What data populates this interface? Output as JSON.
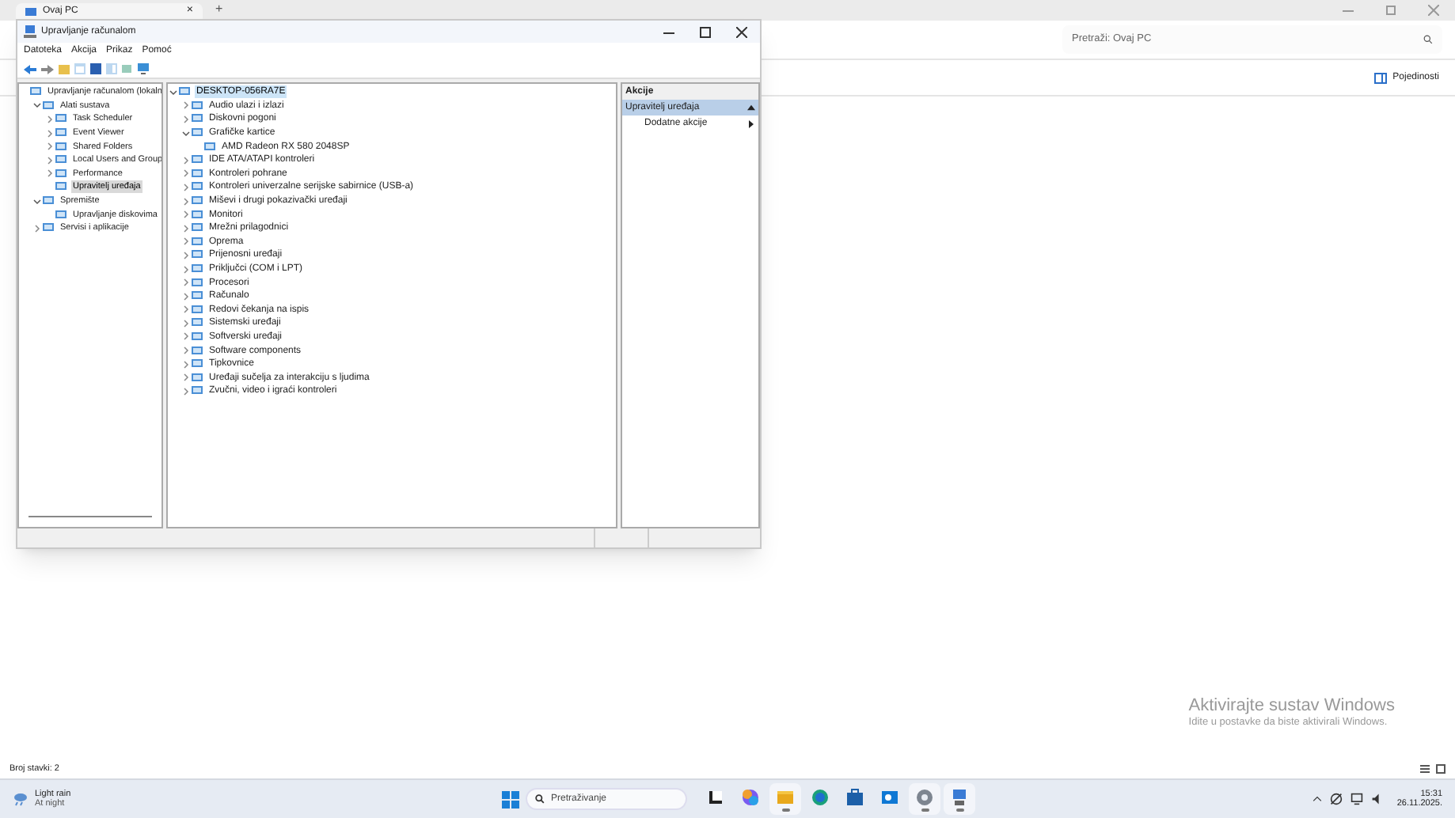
{
  "explorer": {
    "tab_title": "Ovaj PC",
    "tab_close": "×",
    "new_tab": "+",
    "search": {
      "placeholder": "Pretraži: Ovaj PC"
    },
    "details_button": "Pojedinosti",
    "status": "Broj stavki: 2"
  },
  "window": {
    "title": "Upravljanje računalom",
    "menu": [
      "Datoteka",
      "Akcija",
      "Prikaz",
      "Pomoć"
    ],
    "console_tree": [
      {
        "label": "Upravljanje računalom (lokaln",
        "selected": false,
        "children": [
          {
            "label": "Alati sustava",
            "expanded": true,
            "selected": false,
            "children": [
              {
                "label": "Task Scheduler",
                "expanded": false,
                "selected": false
              },
              {
                "label": "Event Viewer",
                "expanded": false,
                "selected": false
              },
              {
                "label": "Shared Folders",
                "expanded": false,
                "selected": false
              },
              {
                "label": "Local Users and Group",
                "expanded": false,
                "selected": false
              },
              {
                "label": "Performance",
                "expanded": false,
                "selected": false
              },
              {
                "label": "Upravitelj uređaja",
                "selected": true
              }
            ]
          },
          {
            "label": "Spremište",
            "expanded": true,
            "selected": false,
            "children": [
              {
                "label": "Upravljanje diskovima",
                "selected": false
              }
            ]
          },
          {
            "label": "Servisi i aplikacije",
            "expanded": false,
            "selected": false
          }
        ]
      }
    ],
    "device_tree": [
      {
        "label": "DESKTOP-056RA7E",
        "expanded": true,
        "selected": true,
        "children": [
          {
            "label": "Audio ulazi i izlazi",
            "expanded": false,
            "selected": false
          },
          {
            "label": "Diskovni pogoni",
            "expanded": false,
            "selected": false
          },
          {
            "label": "Grafičke kartice",
            "expanded": true,
            "selected": false,
            "children": [
              {
                "label": "AMD Radeon RX 580 2048SP",
                "selected": false
              }
            ]
          },
          {
            "label": "IDE ATA/ATAPI kontroleri",
            "expanded": false,
            "selected": false
          },
          {
            "label": "Kontroleri pohrane",
            "expanded": false,
            "selected": false
          },
          {
            "label": "Kontroleri univerzalne serijske sabirnice (USB-a)",
            "expanded": false,
            "selected": false
          },
          {
            "label": "Miševi i drugi pokazivački uređaji",
            "expanded": false,
            "selected": false
          },
          {
            "label": "Monitori",
            "expanded": false,
            "selected": false
          },
          {
            "label": "Mrežni prilagodnici",
            "expanded": false,
            "selected": false
          },
          {
            "label": "Oprema",
            "expanded": false,
            "selected": false
          },
          {
            "label": "Prijenosni uređaji",
            "expanded": false,
            "selected": false
          },
          {
            "label": "Priključci (COM i LPT)",
            "expanded": false,
            "selected": false
          },
          {
            "label": "Procesori",
            "expanded": false,
            "selected": false
          },
          {
            "label": "Računalo",
            "expanded": false,
            "selected": false
          },
          {
            "label": "Redovi čekanja na ispis",
            "expanded": false,
            "selected": false
          },
          {
            "label": "Sistemski uređaji",
            "expanded": false,
            "selected": false
          },
          {
            "label": "Softverski uređaji",
            "expanded": false,
            "selected": false
          },
          {
            "label": "Software components",
            "expanded": false,
            "selected": false
          },
          {
            "label": "Tipkovnice",
            "expanded": false,
            "selected": false
          },
          {
            "label": "Uređaji sučelja za interakciju s ljudima",
            "expanded": false,
            "selected": false
          },
          {
            "label": "Zvučni, video i igraći kontroleri",
            "expanded": false,
            "selected": false
          }
        ]
      }
    ],
    "actions": {
      "header": "Akcije",
      "section": {
        "label": "Upravitelj uređaja",
        "expanded": true
      },
      "items": [
        "Dodatne akcije"
      ]
    }
  },
  "activation": {
    "title": "Aktivirajte sustav Windows",
    "subtitle": "Idite u postavke da biste aktivirali Windows."
  },
  "taskbar": {
    "weather": {
      "title": "Light rain",
      "subtitle": "At night"
    },
    "search": {
      "placeholder": "Pretraživanje"
    },
    "apps": [
      {
        "kind": "taskview",
        "running": false
      },
      {
        "kind": "copilot",
        "running": false
      },
      {
        "kind": "folder",
        "running": true
      },
      {
        "kind": "edge",
        "running": false
      },
      {
        "kind": "store",
        "running": false
      },
      {
        "kind": "outlook",
        "running": false
      },
      {
        "kind": "settings",
        "running": true
      },
      {
        "kind": "computer",
        "running": true
      }
    ],
    "clock": {
      "time": "15:31",
      "date": "26.11.2025."
    }
  }
}
